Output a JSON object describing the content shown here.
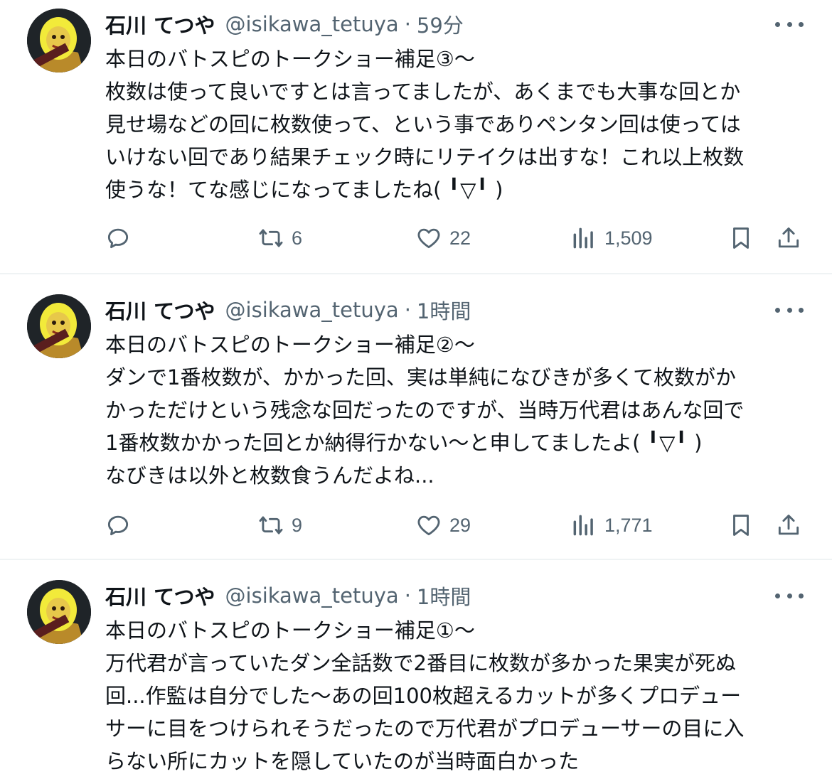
{
  "tweets": [
    {
      "name": "石川 てつや",
      "handle": "@isikawa_tetuya",
      "separator": "·",
      "time": "59分",
      "lines": [
        "本日のバトスピのトークショー補足③〜",
        "枚数は使って良いですとは言ってましたが、あくまでも大事な回とか",
        "見せ場などの回に枚数使って、という事でありペンタン回は使っては",
        "いけない回であり結果チェック時にリテイクは出すな！これ以上枚数",
        "使うな！てな感じになってましたね( ╹▽╹ )"
      ],
      "reply_count": "",
      "retweet_count": "6",
      "like_count": "22",
      "view_count": "1,509"
    },
    {
      "name": "石川 てつや",
      "handle": "@isikawa_tetuya",
      "separator": "·",
      "time": "1時間",
      "lines": [
        "本日のバトスピのトークショー補足②〜",
        "ダンで1番枚数が、かかった回、実は単純になびきが多くて枚数がか",
        "かっただけという残念な回だったのですが、当時万代君はあんな回で",
        "1番枚数かかった回とか納得行かない〜と申してましたよ( ╹▽╹ )",
        "なびきは以外と枚数食うんだよね..."
      ],
      "reply_count": "",
      "retweet_count": "9",
      "like_count": "29",
      "view_count": "1,771"
    },
    {
      "name": "石川 てつや",
      "handle": "@isikawa_tetuya",
      "separator": "·",
      "time": "1時間",
      "lines": [
        "本日のバトスピのトークショー補足①〜",
        "万代君が言っていたダン全話数で2番目に枚数が多かった果実が死ぬ",
        "回...作監は自分でした〜あの回100枚超えるカットが多くプロデュー",
        "サーに目をつけられそうだったので万代君がプロデューサーの目に入",
        "らない所にカットを隠していたのが当時面白かった"
      ]
    }
  ],
  "colors": {
    "text": "#0f1419",
    "secondary": "#536471",
    "divider": "#eff3f4"
  },
  "icons": [
    "reply-icon",
    "retweet-icon",
    "like-icon",
    "views-icon",
    "bookmark-icon",
    "share-icon",
    "more-icon"
  ]
}
